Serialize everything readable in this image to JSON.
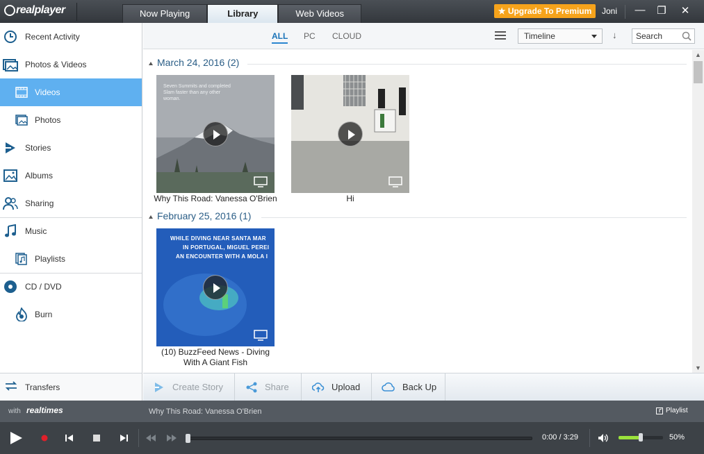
{
  "app": {
    "logo_text": "realplayer",
    "tabs": [
      "Now Playing",
      "Library",
      "Web Videos"
    ],
    "active_tab": "Library",
    "upgrade_label": "Upgrade To Premium",
    "user_name": "Joni"
  },
  "sidebar": {
    "items": [
      {
        "label": "Recent Activity",
        "icon": "clock-icon"
      },
      {
        "label": "Photos & Videos",
        "icon": "photos-videos-icon"
      },
      {
        "label": "Videos",
        "icon": "film-icon",
        "selected": true
      },
      {
        "label": "Photos",
        "icon": "photo-icon"
      },
      {
        "label": "Stories",
        "icon": "stories-icon"
      },
      {
        "label": "Albums",
        "icon": "album-icon"
      },
      {
        "label": "Sharing",
        "icon": "people-icon"
      },
      {
        "label": "Music",
        "icon": "music-note-icon"
      },
      {
        "label": "Playlists",
        "icon": "playlist-icon"
      },
      {
        "label": "CD / DVD",
        "icon": "disc-icon"
      },
      {
        "label": "Burn",
        "icon": "burn-icon"
      }
    ],
    "transfers_label": "Transfers"
  },
  "toolbar": {
    "filters": [
      "ALL",
      "PC",
      "CLOUD"
    ],
    "active_filter": "ALL",
    "view_select": "Timeline",
    "search_placeholder": "Search"
  },
  "library": {
    "groups": [
      {
        "title": "March 24, 2016 (2)",
        "items": [
          {
            "caption": "Why This Road: Vanessa O'Brien"
          },
          {
            "caption": "Hi"
          }
        ]
      },
      {
        "title": "February 25, 2016 (1)",
        "items": [
          {
            "caption": "(10) BuzzFeed News - Diving With A Giant Fish"
          }
        ]
      }
    ],
    "thumb1_overlay": "Seven Summits and completed Slam faster than any other woman.",
    "thumb3_overlay_lines": [
      "WHILE DIVING NEAR SANTA MAR",
      "IN PORTUGAL, MIGUEL PEREI",
      "AN ENCOUNTER WITH A MOLA I"
    ]
  },
  "actions": {
    "create_story": "Create Story",
    "share": "Share",
    "upload": "Upload",
    "backup": "Back Up"
  },
  "player": {
    "with_label": "with",
    "realtimes_label": "realtimes",
    "now_playing_title": "Why This Road: Vanessa O'Brien",
    "playlist_label": "Playlist",
    "time": "0:00 / 3:29",
    "volume": "50%",
    "volume_level": 0.5,
    "progress": 0.0
  },
  "colors": {
    "accent": "#5fb0f0",
    "upgrade": "#f6a31b",
    "volume_fill": "#9be23c",
    "record": "#e0202a"
  }
}
